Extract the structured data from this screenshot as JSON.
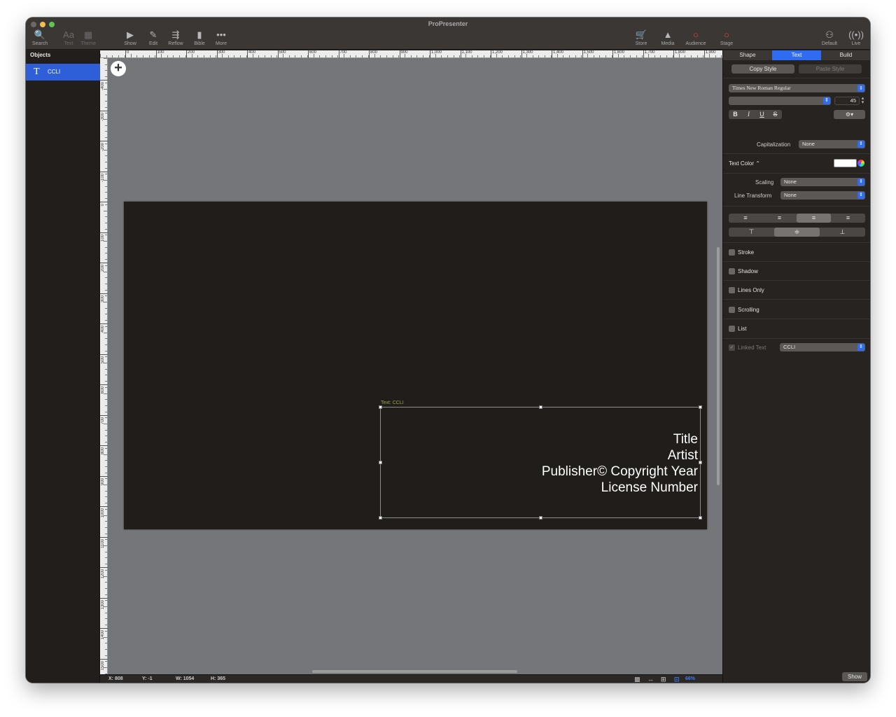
{
  "window": {
    "title": "ProPresenter"
  },
  "toolbar": {
    "left": [
      {
        "name": "search",
        "icon": "search-icon",
        "glyph": "🔍",
        "label": "Search",
        "dim": false
      },
      {
        "name": "text",
        "icon": "text-style-icon",
        "glyph": "Aa",
        "label": "Text",
        "dim": true
      },
      {
        "name": "theme",
        "icon": "theme-icon",
        "glyph": "▦",
        "label": "Theme",
        "dim": true
      },
      {
        "name": "show",
        "icon": "play-icon",
        "glyph": "▶",
        "label": "Show",
        "dim": false
      },
      {
        "name": "edit",
        "icon": "pencil-icon",
        "glyph": "✎",
        "label": "Edit",
        "dim": false
      },
      {
        "name": "reflow",
        "icon": "reflow-icon",
        "glyph": "⇶",
        "label": "Reflow",
        "dim": false
      },
      {
        "name": "bible",
        "icon": "bible-icon",
        "glyph": "▮",
        "label": "Bible",
        "dim": false
      },
      {
        "name": "more",
        "icon": "more-icon",
        "glyph": "•••",
        "label": "More",
        "dim": false
      }
    ],
    "right": [
      {
        "name": "store",
        "icon": "cart-icon",
        "glyph": "🛒",
        "label": "Store",
        "red": false
      },
      {
        "name": "media",
        "icon": "media-icon",
        "glyph": "▲",
        "label": "Media",
        "red": false
      },
      {
        "name": "audience",
        "icon": "audience-icon",
        "glyph": "○",
        "label": "Audience",
        "red": true
      },
      {
        "name": "stage",
        "icon": "stage-icon",
        "glyph": "○",
        "label": "Stage",
        "red": true
      },
      {
        "name": "default",
        "icon": "mask-icon",
        "glyph": "⚇",
        "label": "Default",
        "red": false
      },
      {
        "name": "live",
        "icon": "broadcast-icon",
        "glyph": "((•))",
        "label": "Live",
        "red": false
      }
    ]
  },
  "objects": {
    "title": "Objects",
    "items": [
      {
        "icon_glyph": "T",
        "label": "CCLI"
      }
    ]
  },
  "ruler": {
    "top": [
      "0",
      "100",
      "200",
      "300",
      "400",
      "500",
      "600",
      "700",
      "800",
      "900",
      "1,000",
      "1,100",
      "1,200",
      "1,300",
      "1,400",
      "1,500",
      "1,600",
      "1,700",
      "1,800",
      "1,900"
    ],
    "left_neg": [
      "-400",
      "-300",
      "-200",
      "-100"
    ],
    "left_pos": [
      "0",
      "100",
      "200",
      "300",
      "400",
      "500",
      "600",
      "700",
      "800",
      "900",
      "1000",
      "1100",
      "1200",
      "1300",
      "1400",
      "1500"
    ]
  },
  "canvas": {
    "add_glyph": "+",
    "textbox_label": "Text: CCLI",
    "textbox_lines": [
      "Title",
      "Artist",
      "Publisher© Copyright Year",
      "License Number"
    ]
  },
  "status": {
    "x": "X: 808",
    "y": "Y: -1",
    "w": "W: 1054",
    "h": "H: 365",
    "zoom": "66%"
  },
  "inspector": {
    "tabs": [
      "Shape",
      "Text",
      "Build"
    ],
    "active_tab": "Text",
    "copy_style": "Copy Style",
    "paste_style": "Paste Style",
    "font_family": "Times New Roman Regular",
    "font_style": "",
    "font_size": "45",
    "format_buttons": [
      "B",
      "I",
      "U",
      "S"
    ],
    "gear_glyph": "⚙▾",
    "capitalization_label": "Capitalization",
    "capitalization_value": "None",
    "text_color_label": "Text Color ⌃",
    "text_color": "#ffffff",
    "scaling_label": "Scaling",
    "scaling_value": "None",
    "line_transform_label": "Line Transform",
    "line_transform_value": "None",
    "h_align": [
      "≡",
      "≡",
      "≡",
      "≡"
    ],
    "h_align_active": 2,
    "v_align": [
      "⊤",
      "≑",
      "⊥"
    ],
    "v_align_active": 1,
    "options": [
      "Stroke",
      "Shadow",
      "Lines Only",
      "Scrolling",
      "List"
    ],
    "linked_text_label": "Linked Text",
    "linked_text_value": "CCLI",
    "show_button": "Show"
  },
  "colors": {
    "accent": "#2f6cf2",
    "slide_bg": "#201d1b",
    "canvas_bg": "#757679",
    "red": "#e8453c"
  }
}
